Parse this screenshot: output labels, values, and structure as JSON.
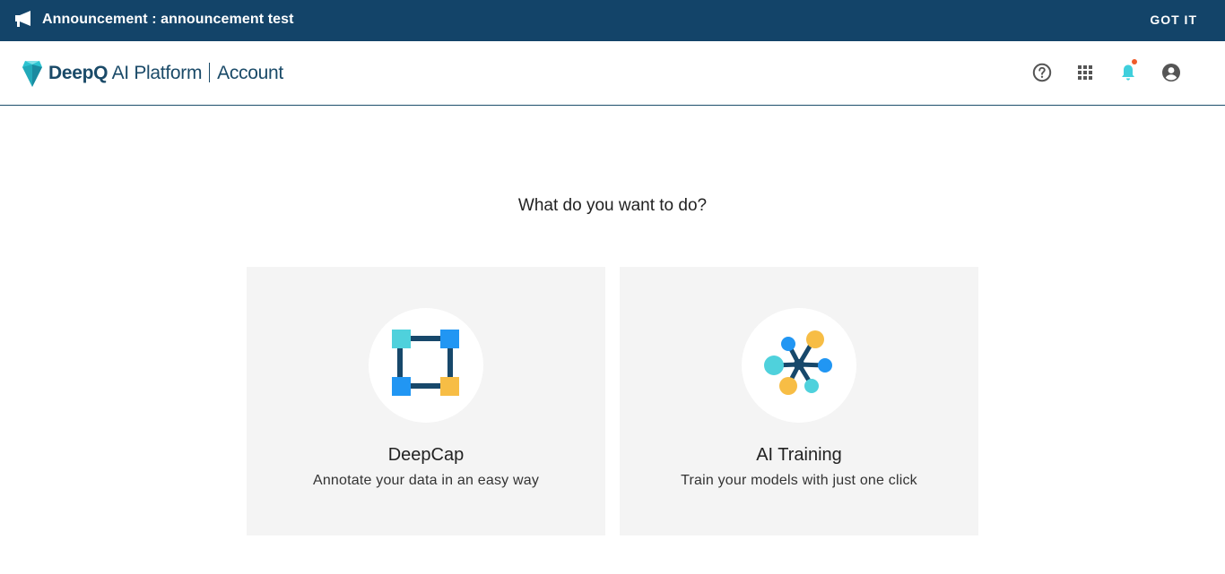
{
  "announcement": {
    "text": "Announcement : announcement test",
    "dismiss_label": "GOT IT",
    "icon": "megaphone-icon"
  },
  "header": {
    "brand_name": "DeepQ",
    "brand_product": "AI Platform",
    "brand_section": "Account",
    "icons": [
      "help-icon",
      "apps-grid-icon",
      "notification-bell-icon",
      "account-icon"
    ],
    "notification_dot_color": "#ef5b2a"
  },
  "main": {
    "question": "What do you want to do?",
    "cards": [
      {
        "title": "DeepCap",
        "subtitle": "Annotate your data in an easy way",
        "icon": "deepcap-icon"
      },
      {
        "title": "AI Training",
        "subtitle": "Train your models with just one click",
        "icon": "ai-training-icon"
      }
    ]
  },
  "colors": {
    "announcement_bg": "#134469",
    "brand": "#1a4a68",
    "card_bg": "#f4f4f4",
    "accent_cyan": "#4fd1dc",
    "accent_blue": "#2196f3",
    "accent_yellow": "#f7bd45"
  }
}
